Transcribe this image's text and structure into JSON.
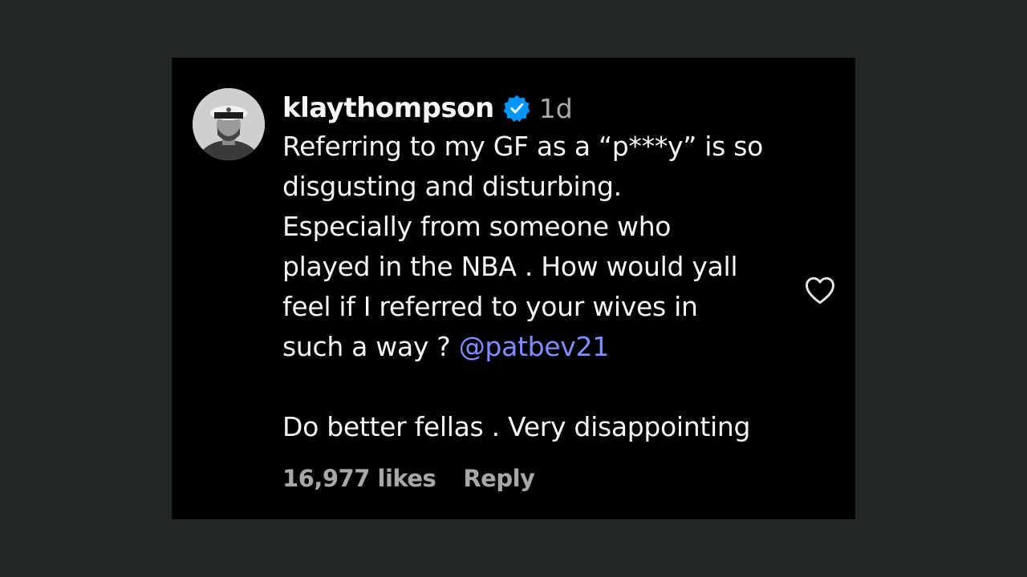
{
  "comment": {
    "username": "klaythompson",
    "time": "1d",
    "lines": [
      "Referring to my GF as a “p***y” is so",
      "disgusting and disturbing.",
      "Especially from someone who",
      "played in the NBA . How would yall",
      "feel if I referred to your wives in"
    ],
    "last_line_prefix": "such a way ? ",
    "mention": "@patbev21",
    "closing": "Do better fellas . Very disappointing",
    "likes": "16,977 likes",
    "reply_label": "Reply"
  },
  "colors": {
    "background": "#222627",
    "card": "#000000",
    "text": "#f5f5f5",
    "muted": "#a8a8a8",
    "mention": "#7f8dff",
    "verified": "#0095f6"
  },
  "icons": {
    "verified": "verified-badge-icon",
    "like": "heart-outline-icon"
  }
}
